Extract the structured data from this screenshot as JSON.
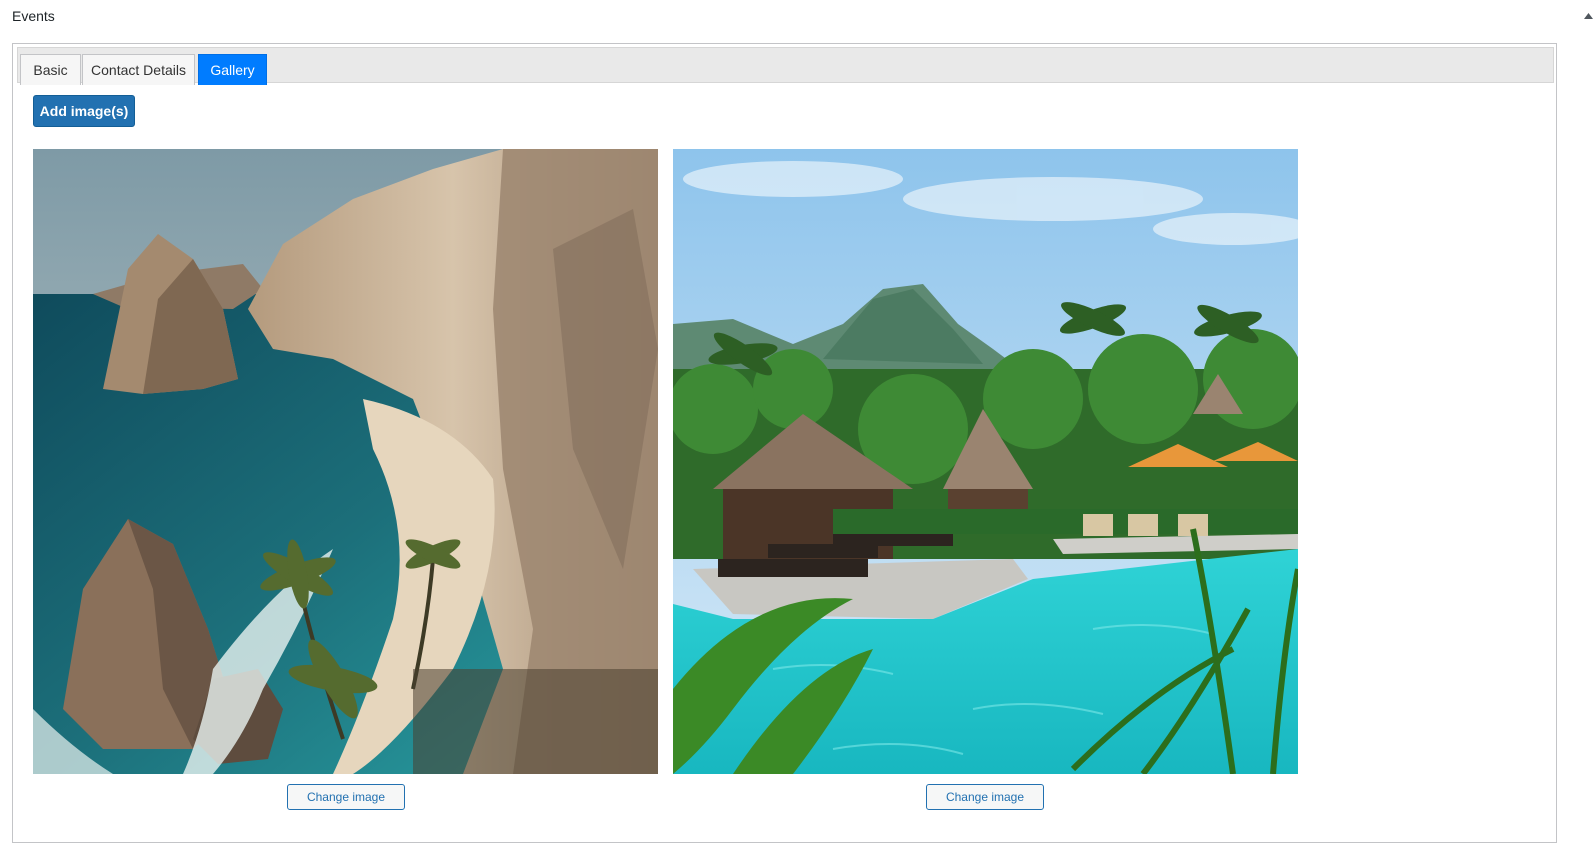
{
  "metabox": {
    "title": "Events",
    "toggle_icon": "triangle-up-icon"
  },
  "tabs": [
    {
      "label": "Basic",
      "active": false
    },
    {
      "label": "Contact Details",
      "active": false
    },
    {
      "label": "Gallery",
      "active": true
    }
  ],
  "gallery": {
    "add_button_label": "Add image(s)",
    "images": [
      {
        "subject": "coastal cliffs with turquoise sea and palm trees",
        "change_label": "Change image"
      },
      {
        "subject": "tropical resort pool with thatched huts and mountains",
        "change_label": "Change image"
      }
    ]
  },
  "colors": {
    "active_tab": "#007cff",
    "primary_button": "#2271b1",
    "link_blue": "#2271b1",
    "border": "#c3c4c7"
  }
}
